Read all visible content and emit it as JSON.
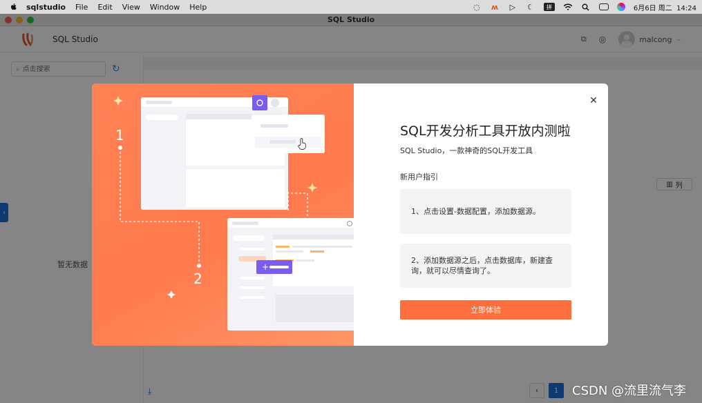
{
  "menubar": {
    "app_name": "sqlstudio",
    "items": [
      "File",
      "Edit",
      "View",
      "Window",
      "Help"
    ],
    "date_time": "6月6日 周二  14:24"
  },
  "window": {
    "title": "SQL Studio"
  },
  "header": {
    "brand": "SQL Studio",
    "username": "malcong"
  },
  "sidebar": {
    "search_placeholder": "点击搜索",
    "empty_text": "暂无数据"
  },
  "main": {
    "columns_button": "列",
    "current_page": "1"
  },
  "watermark": "CSDN @流里流气李",
  "modal": {
    "title": "SQL开发分析工具开放内测啦",
    "subtitle": "SQL Studio，一款神奇的SQL开发工具",
    "guide_heading": "新用户指引",
    "steps": [
      "1、点击设置-数据配置，添加数据源。",
      "2、添加数据源之后，点击数据库，新建查询，就可以尽情查询了。"
    ],
    "cta_label": "立即体验",
    "illustration": {
      "step_numbers": [
        "1",
        "2"
      ]
    }
  },
  "colors": {
    "accent": "#ff6e3d",
    "primary_blue": "#1a6fd6"
  }
}
